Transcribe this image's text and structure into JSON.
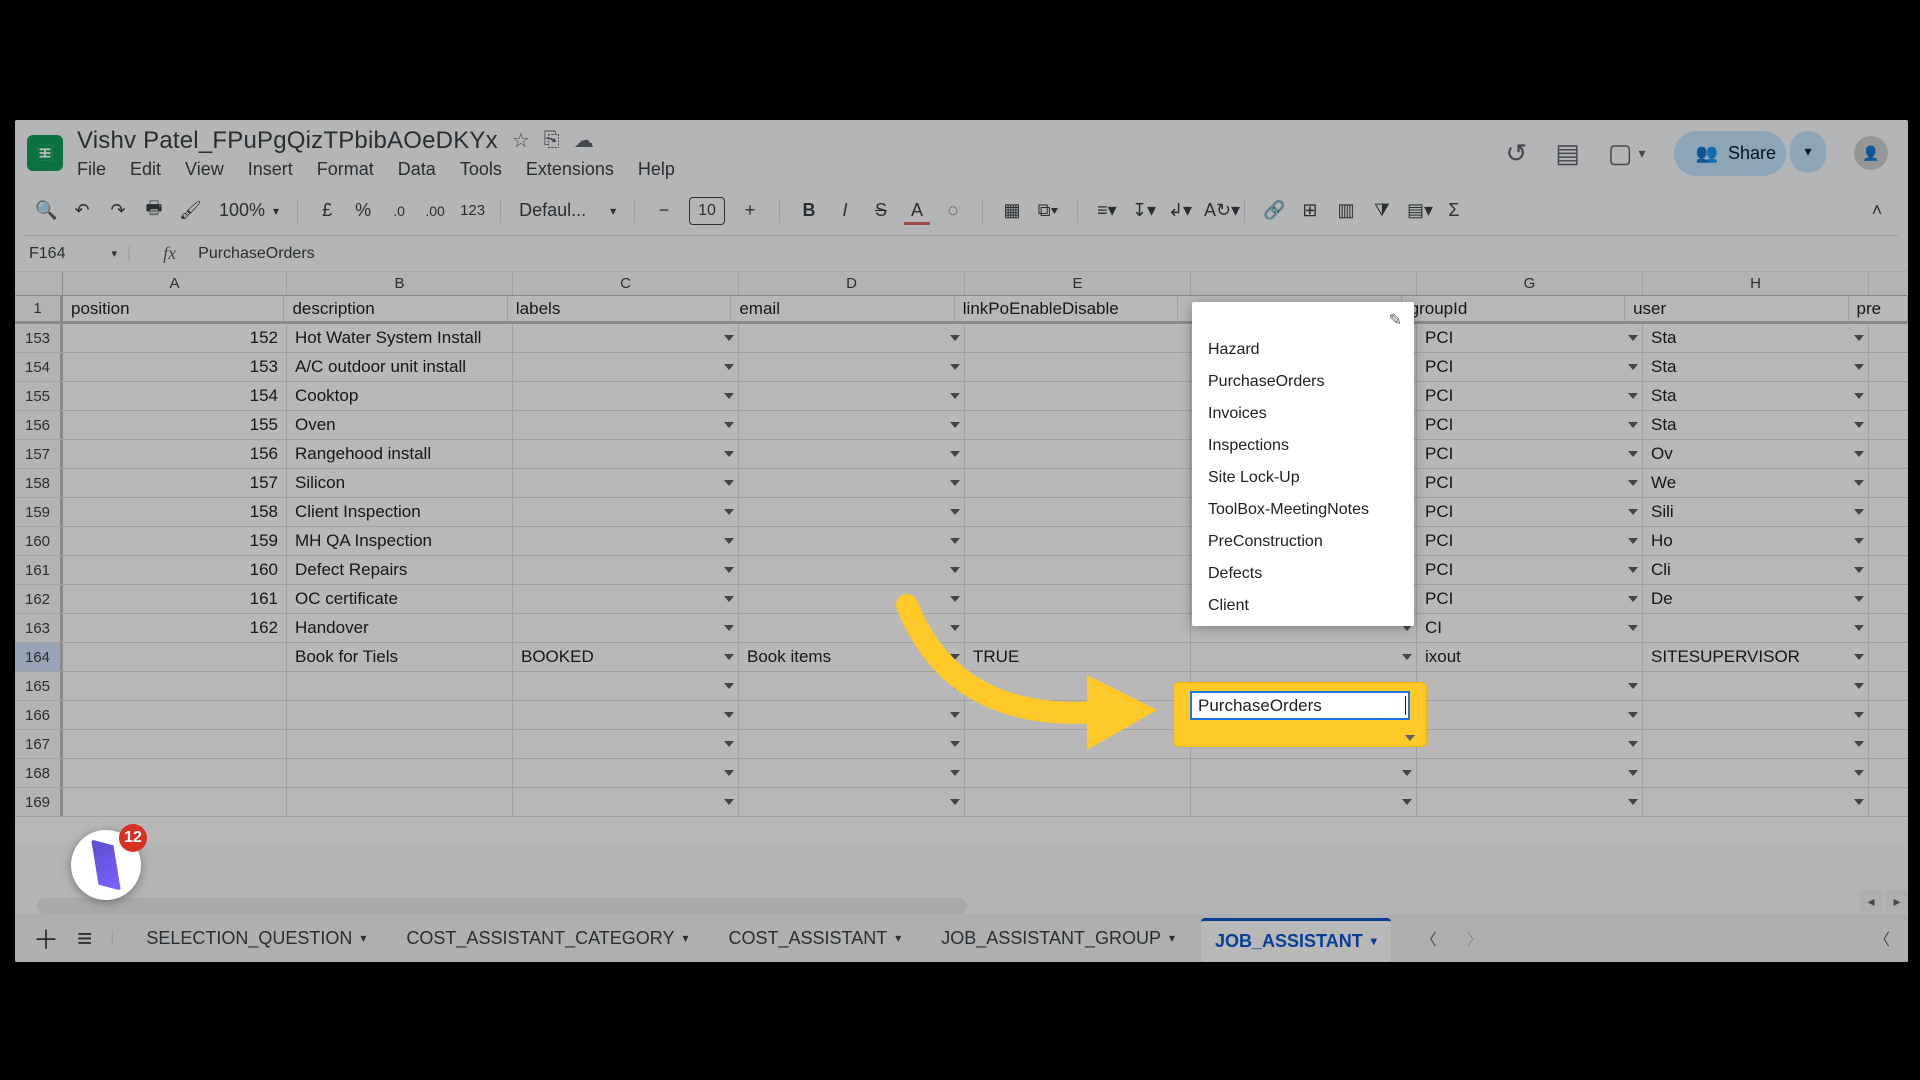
{
  "doc": {
    "title": "Vishv Patel_FPuPgQizTPbibAOeDKYx"
  },
  "menu": {
    "file": "File",
    "edit": "Edit",
    "view": "View",
    "insert": "Insert",
    "format": "Format",
    "data": "Data",
    "tools": "Tools",
    "extensions": "Extensions",
    "help": "Help"
  },
  "share": {
    "label": "Share"
  },
  "toolbar": {
    "zoom": "100%",
    "currency": "£",
    "percent": "%",
    "decDec": ".0",
    "incDec": ".00",
    "num123": "123",
    "font": "Defaul...",
    "fontsize": "10"
  },
  "namebox": {
    "ref": "F164"
  },
  "formula": {
    "value": "PurchaseOrders"
  },
  "columns": {
    "a": "A",
    "b": "B",
    "c": "C",
    "d": "D",
    "e": "E",
    "g": "G",
    "h": "H"
  },
  "headers": {
    "a": "position",
    "b": "description",
    "c": "labels",
    "d": "email",
    "e": "linkPoEnableDisable",
    "g": "groupId",
    "h": "user",
    "i": "pre"
  },
  "rows": [
    {
      "n": "153",
      "a": "152",
      "b": "Hot Water System Install",
      "g": "PCI",
      "h": "Sta"
    },
    {
      "n": "154",
      "a": "153",
      "b": "A/C outdoor unit install",
      "g": "PCI",
      "h": "Sta"
    },
    {
      "n": "155",
      "a": "154",
      "b": "Cooktop",
      "g": "PCI",
      "h": "Sta"
    },
    {
      "n": "156",
      "a": "155",
      "b": "Oven",
      "g": "PCI",
      "h": "Sta"
    },
    {
      "n": "157",
      "a": "156",
      "b": "Rangehood install",
      "g": "PCI",
      "h": "Ov"
    },
    {
      "n": "158",
      "a": "157",
      "b": "Silicon",
      "g": "PCI",
      "h": "We"
    },
    {
      "n": "159",
      "a": "158",
      "b": "Client Inspection",
      "g": "PCI",
      "h": "Sili"
    },
    {
      "n": "160",
      "a": "159",
      "b": "MH QA Inspection",
      "g": "PCI",
      "h": "Ho"
    },
    {
      "n": "161",
      "a": "160",
      "b": "Defect Repairs",
      "g": "PCI",
      "h": "Cli"
    },
    {
      "n": "162",
      "a": "161",
      "b": "OC certificate",
      "g": "PCI",
      "h": "De"
    },
    {
      "n": "163",
      "a": "162",
      "b": "Handover",
      "g": "CI",
      "h": ""
    },
    {
      "n": "164",
      "a": "",
      "b": "Book for Tiels",
      "c": "BOOKED",
      "d": "Book items",
      "e": "TRUE",
      "g": "ixout",
      "gh": "SITESUPERVISOR",
      "sel": true
    },
    {
      "n": "165"
    },
    {
      "n": "166"
    },
    {
      "n": "167"
    },
    {
      "n": "168"
    },
    {
      "n": "169"
    }
  ],
  "headerRowNum": "1",
  "dropdown": {
    "items": [
      "Hazard",
      "PurchaseOrders",
      "Invoices",
      "Inspections",
      "Site Lock-Up",
      "ToolBox-MeetingNotes",
      "PreConstruction",
      "Defects",
      "Client"
    ]
  },
  "activeCell": {
    "value": "PurchaseOrders"
  },
  "tabs": [
    {
      "label": "SELECTION_QUESTION"
    },
    {
      "label": "COST_ASSISTANT_CATEGORY"
    },
    {
      "label": "COST_ASSISTANT"
    },
    {
      "label": "JOB_ASSISTANT_GROUP"
    },
    {
      "label": "JOB_ASSISTANT",
      "active": true
    }
  ],
  "badge": {
    "count": "12"
  }
}
